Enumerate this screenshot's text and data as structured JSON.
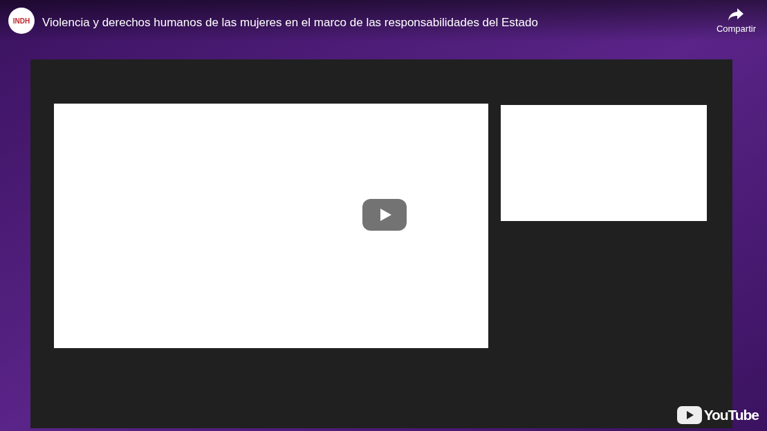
{
  "player": {
    "channel_avatar": "INDH",
    "title": "Violencia y derechos humanos de las mujeres en el marco de las responsabilidades del Estado",
    "share_label": "Compartir",
    "logo_text": "YouTube"
  }
}
